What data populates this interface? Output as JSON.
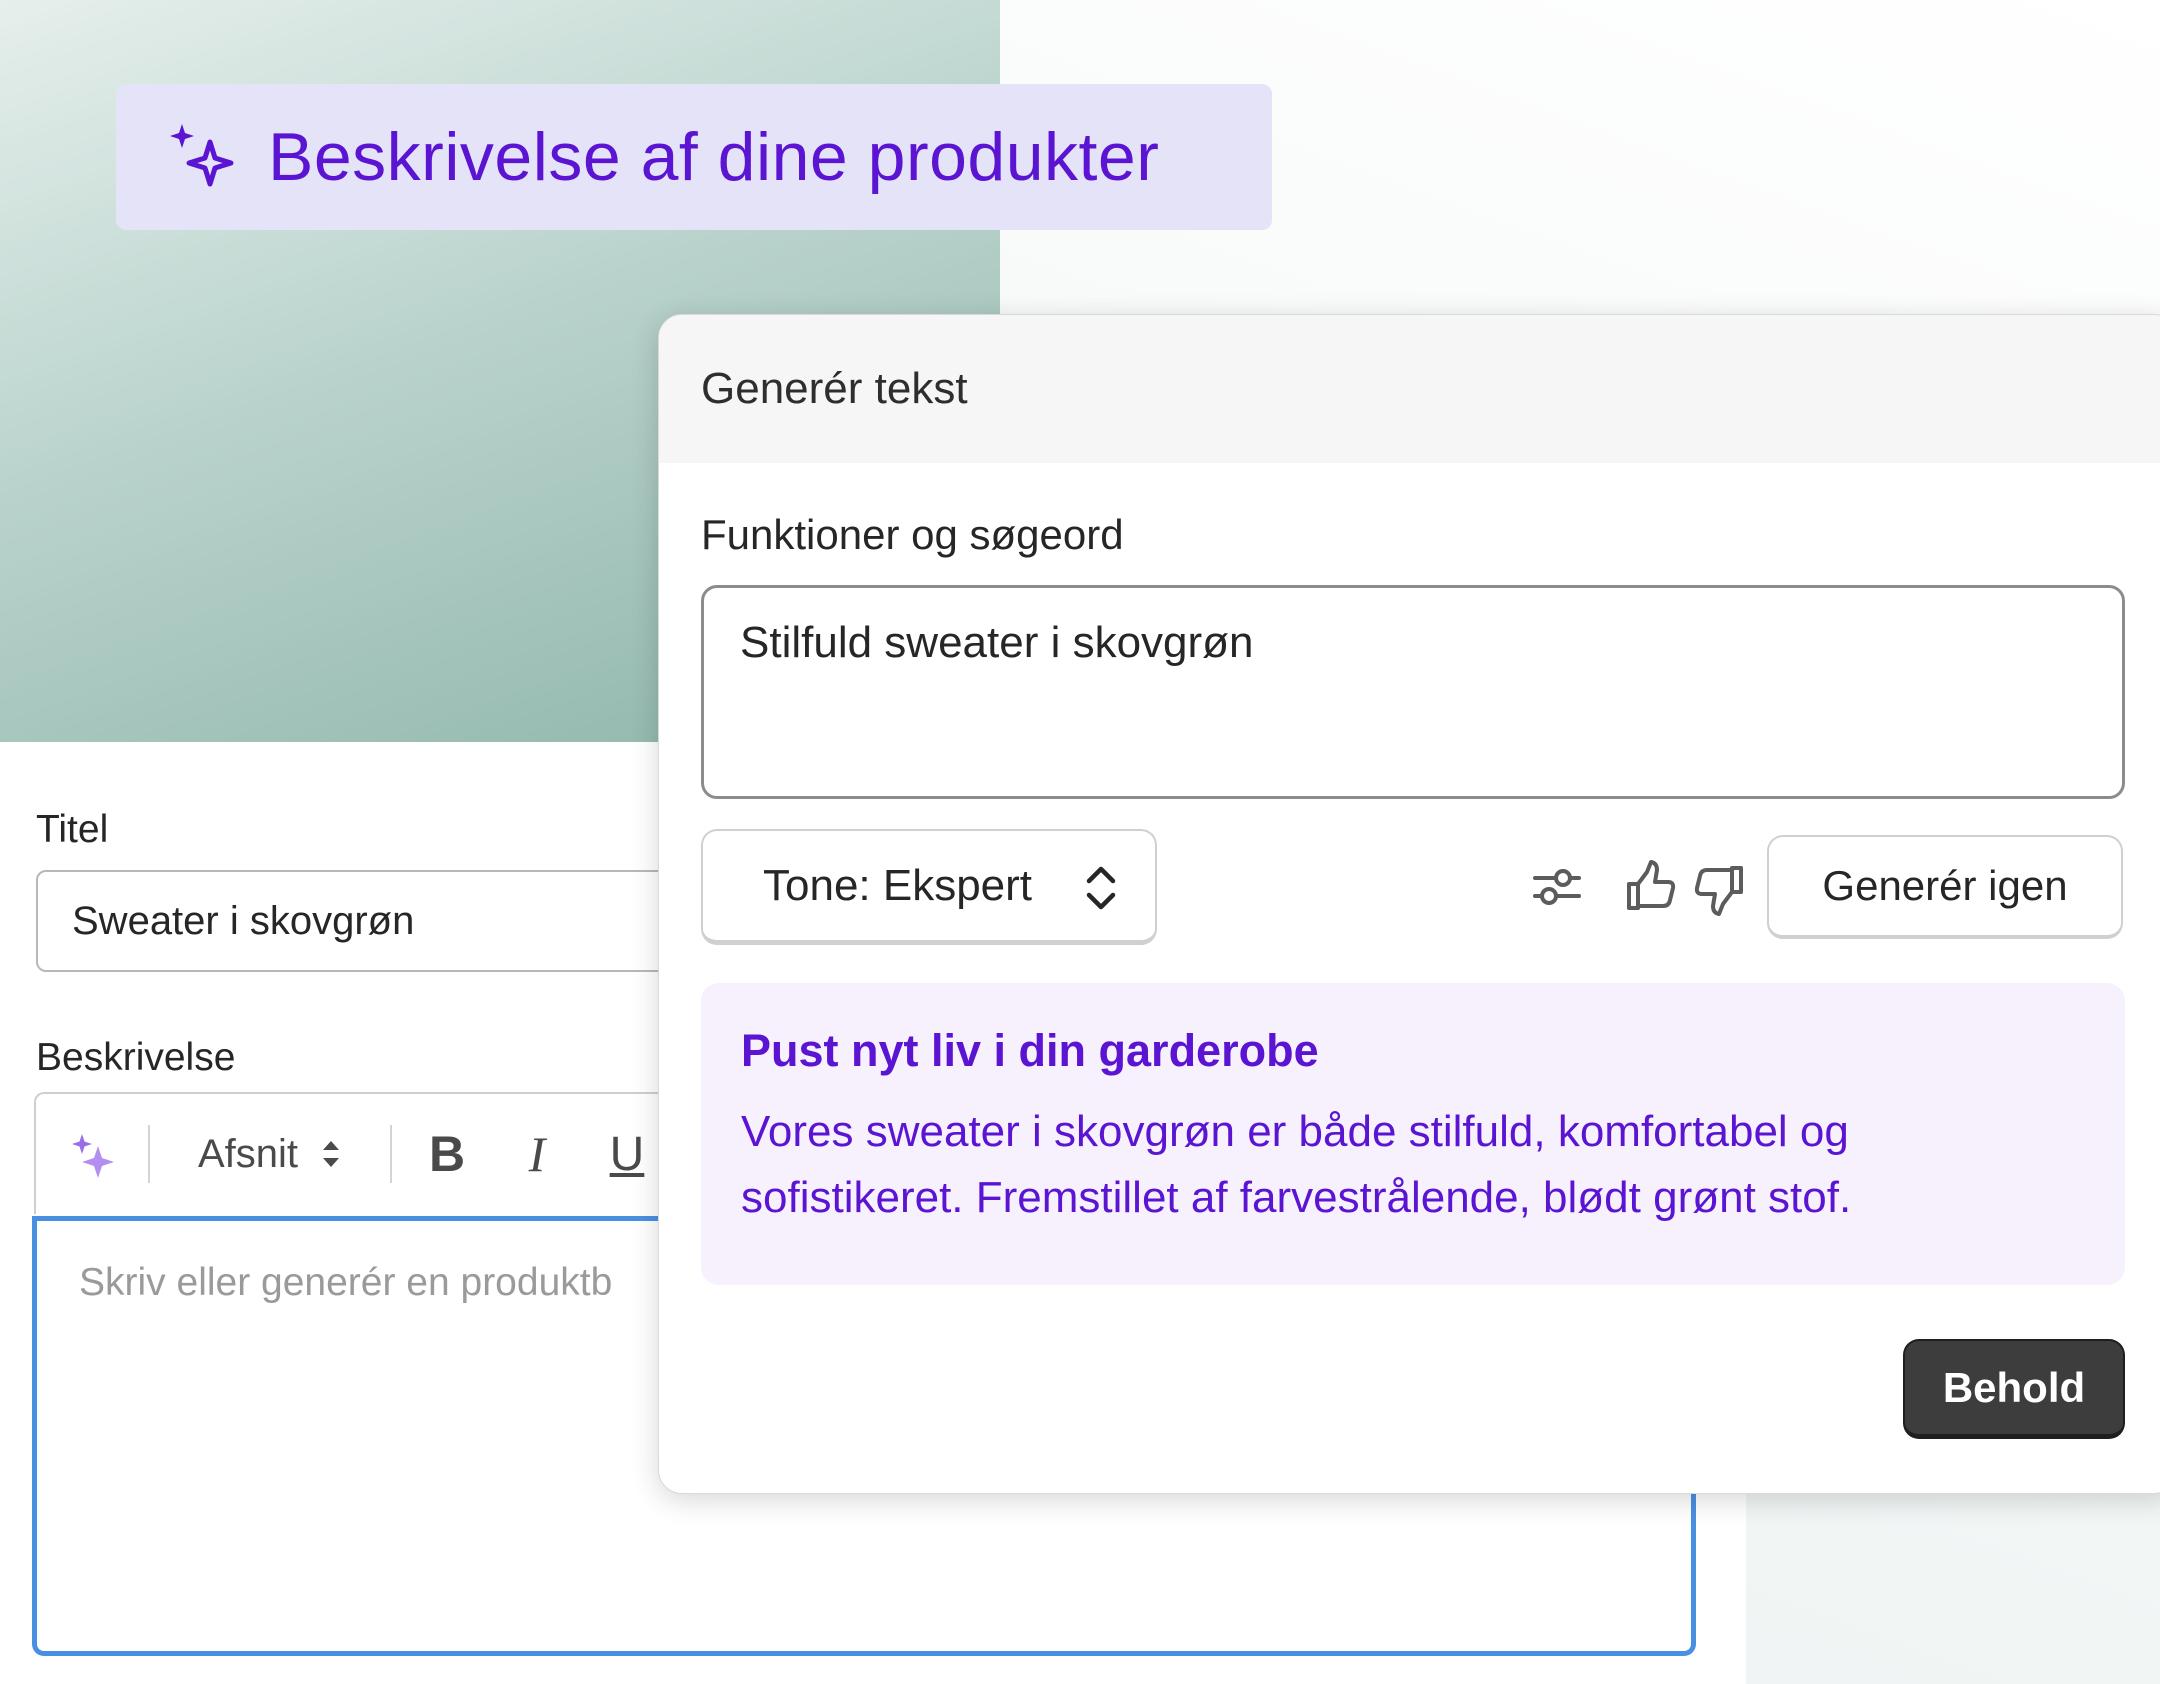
{
  "hero": {
    "title": "Beskrivelse af dine produkter"
  },
  "product_form": {
    "title_label": "Titel",
    "title_value": "Sweater i skovgrøn",
    "description_label": "Beskrivelse",
    "toolbar": {
      "format_select": "Afsnit",
      "bold": "B",
      "italic": "I",
      "underline": "U"
    },
    "description_placeholder": "Skriv eller generér en produktb"
  },
  "generate_modal": {
    "header": "Generér tekst",
    "keywords_label": "Funktioner og søgeord",
    "keywords_value": "Stilfuld sweater i skovgrøn",
    "tone_select": "Tone: Ekspert",
    "regenerate_button": "Generér igen",
    "result_heading": "Pust nyt liv i din garderobe",
    "result_body_line1": "Vores sweater i skovgrøn er både stilfuld, komfortabel og",
    "result_body_line2": "sofistikeret. Fremstillet af farvestrålende, blødt grønt stof.",
    "keep_button": "Behold"
  },
  "colors": {
    "accent_purple": "#5a14d2",
    "focus_blue": "#4a90e2",
    "dark_button": "#3d3d3d"
  },
  "icons": [
    "sparkle-icon",
    "chevron-up-down-icon",
    "settings-sliders-icon",
    "thumbs-up-icon",
    "thumbs-down-icon"
  ]
}
